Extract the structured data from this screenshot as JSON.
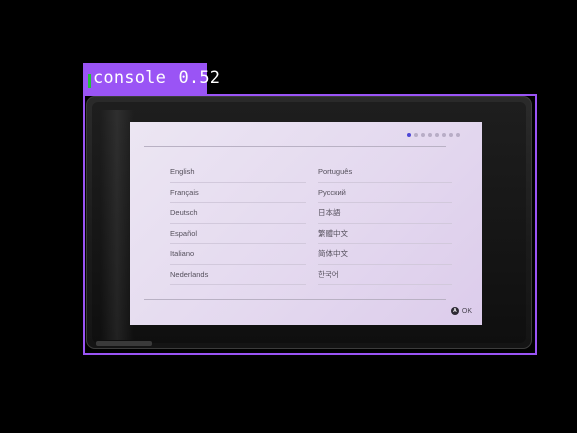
{
  "detection": {
    "label": "console",
    "score": "0.52",
    "box_color": "#9a54f5"
  },
  "screen": {
    "pagination": {
      "total": 8,
      "active_index": 0
    },
    "languages_left": [
      "English",
      "Français",
      "Deutsch",
      "Español",
      "Italiano",
      "Nederlands"
    ],
    "languages_right": [
      "Português",
      "Русский",
      "日本語",
      "繁體中文",
      "简体中文",
      "한국어"
    ],
    "confirm": {
      "button_glyph": "A",
      "label": "OK"
    }
  }
}
